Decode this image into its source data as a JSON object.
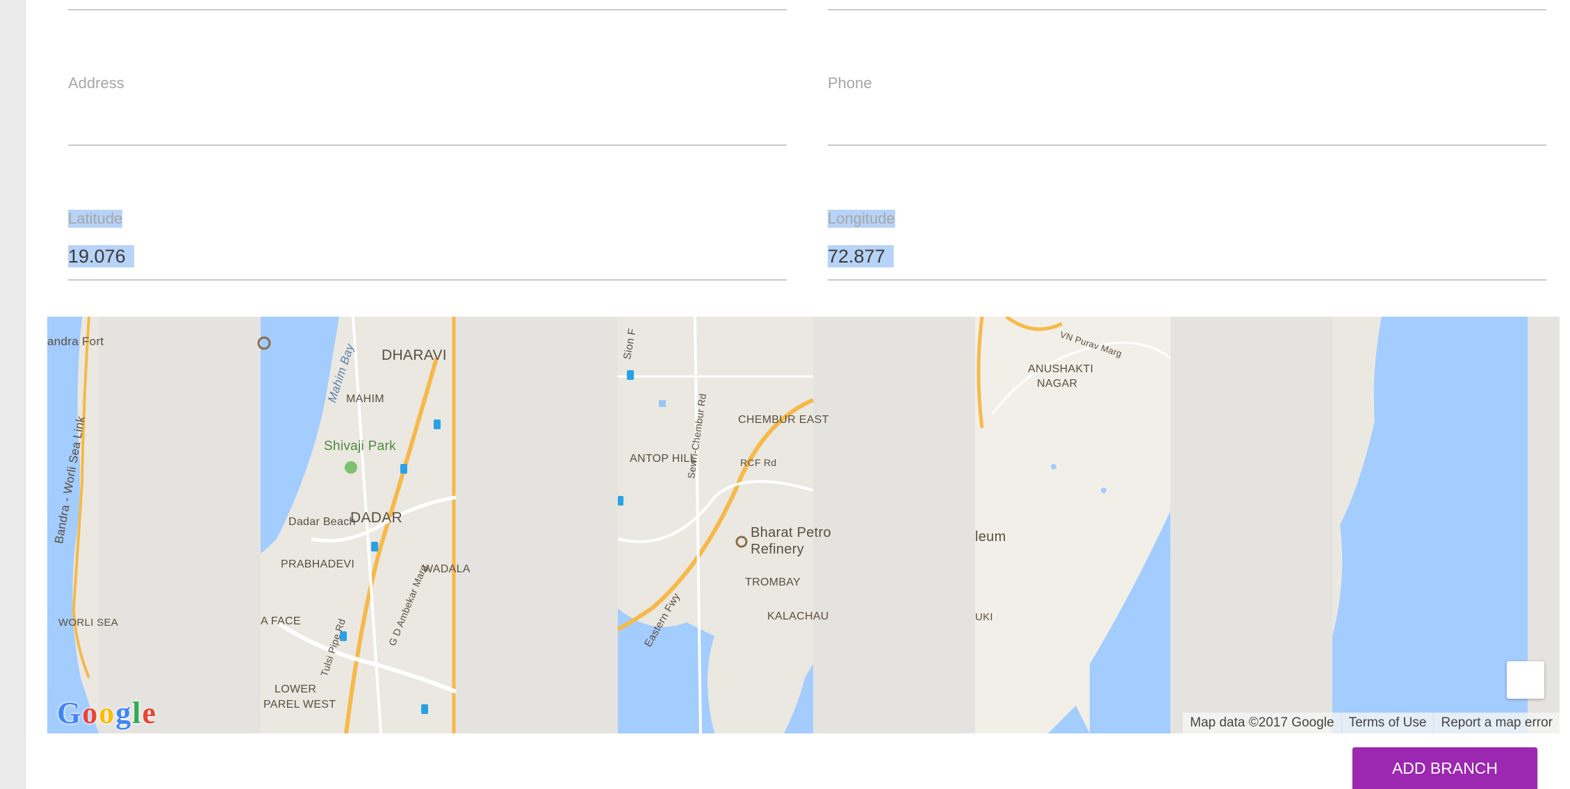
{
  "form": {
    "address_label": "Address",
    "phone_label": "Phone",
    "latitude_label": "Latitude",
    "latitude_value": "19.076",
    "longitude_label": "Longitude",
    "longitude_value": "72.877"
  },
  "map": {
    "labels": {
      "bandra_fort": "andra Fort",
      "worli_sea_link": "Bandra - Worli Sea Link",
      "worli_sea": "WORLI SEA",
      "dharavi": "DHARAVI",
      "mahim": "MAHIM",
      "mahim_bay": "Mahim Bay",
      "shivaji_park": "Shivaji Park",
      "dadar_beach": "Dadar Beach",
      "dadar": "DADAR",
      "prabhadevi": "PRABHADEVI",
      "wadala": "WADALA",
      "gd_ambekar_marg": "G D Ambekar Marg",
      "tulsi_pipe_rd": "Tulsi Pipe Rd",
      "a_face": "A FACE",
      "lower_parel_west_1": "LOWER",
      "lower_parel_west_2": "PAREL WEST",
      "sion": "Sion F",
      "sewri_chembur_rd": "Sewri-Chembur Rd",
      "antop_hill": "ANTOP HILL",
      "chembur_east": "CHEMBUR EAST",
      "rcf_rd": "RCF Rd",
      "bharat_petro_1": "Bharat Petro",
      "bharat_petro_2": "Refinery",
      "trombay": "TROMBAY",
      "kalachauki": "KALACHAU",
      "eastern_fwy": "Eastern Fwy",
      "vn_purav_marg": "VN Purav Marg",
      "anushakti_1": "ANUSHAKTI",
      "anushakti_2": "NAGAR",
      "leum": "leum",
      "uki": "UKI"
    },
    "logo_text": "Google",
    "attribution": {
      "map_data": "Map data ©2017 Google",
      "terms": "Terms of Use",
      "report": "Report a map error"
    }
  },
  "actions": {
    "add_branch": "ADD BRANCH"
  },
  "colors": {
    "accent": "#9c27b0",
    "water": "#a3ccff",
    "selection": "#b7d3f7"
  }
}
